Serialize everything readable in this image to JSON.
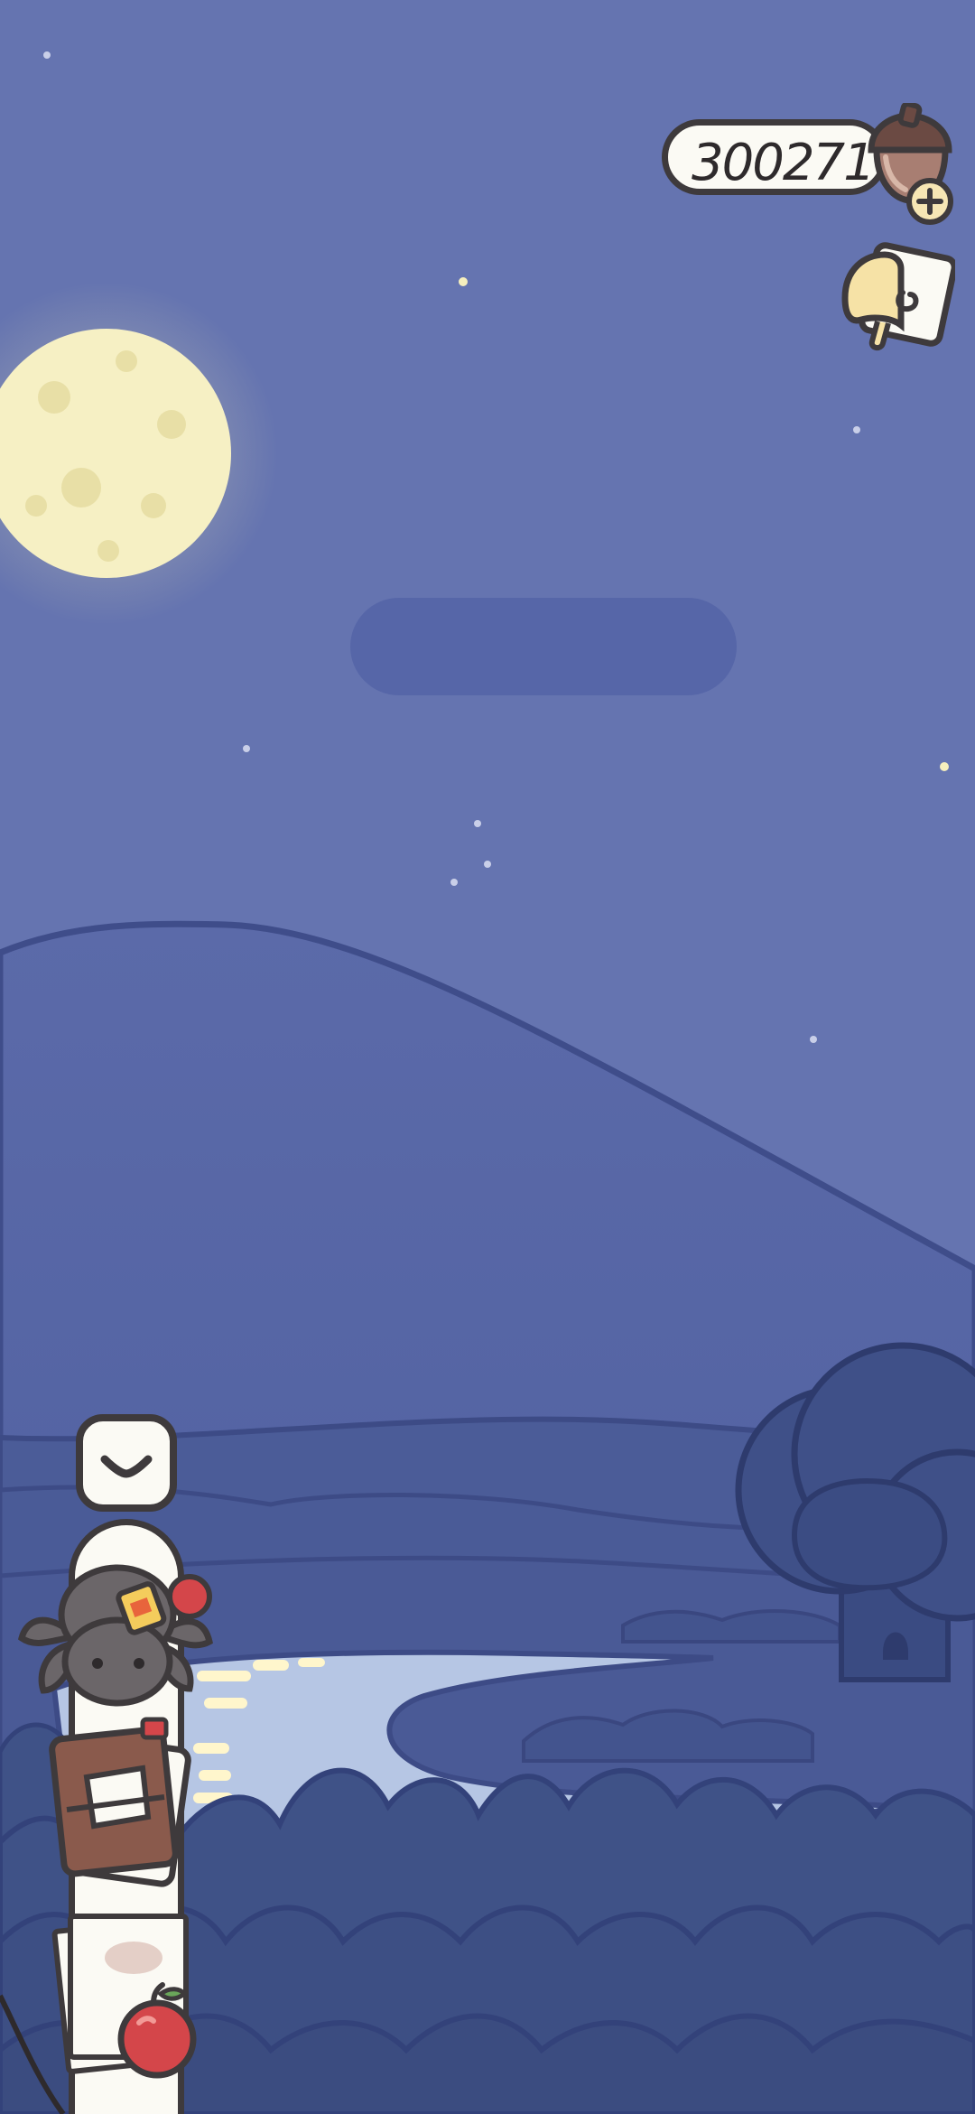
{
  "hud": {
    "acorn_count": "300271",
    "acorn_icon": "acorn-icon",
    "add_icon": "plus-icon",
    "notes_icon": "letter-notes-icon"
  },
  "side_menu": {
    "collapse_icon": "chevron-down-icon",
    "items": [
      {
        "icon": "spider-icon"
      },
      {
        "icon": "journal-book-icon"
      },
      {
        "icon": "letter-apple-icon"
      }
    ]
  },
  "colors": {
    "sky": "#6574b0",
    "moon": "#f6f0c4",
    "mountain": "#5667a6",
    "hills": "#4a5c98",
    "lake": "#b6c6e4",
    "trees": "#3f5287",
    "outline": "#3e3a3c",
    "ui_panel": "#fbfaf4"
  }
}
